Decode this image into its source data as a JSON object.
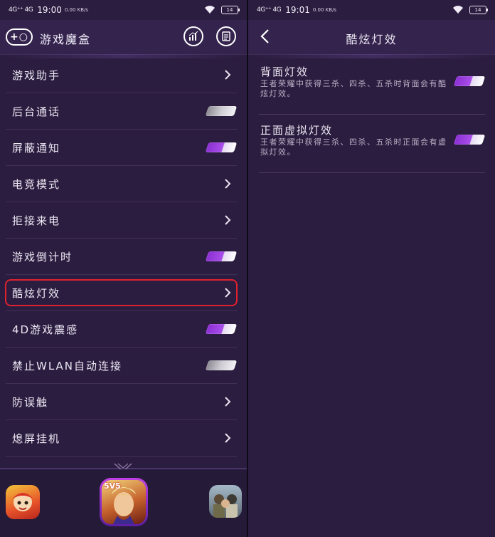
{
  "left": {
    "status": {
      "signal": "4G⁺⁺ 4G",
      "time": "19:00",
      "speed": "0.00 KB/s",
      "battery": "14"
    },
    "header": {
      "title": "游戏魔盒",
      "add_label": "+○"
    },
    "rows": [
      {
        "label": "游戏助手",
        "type": "chevron"
      },
      {
        "label": "后台通话",
        "type": "toggle",
        "on": false
      },
      {
        "label": "屏蔽通知",
        "type": "toggle",
        "on": true
      },
      {
        "label": "电竞模式",
        "type": "chevron"
      },
      {
        "label": "拒接来电",
        "type": "chevron"
      },
      {
        "label": "游戏倒计时",
        "type": "toggle",
        "on": true
      },
      {
        "label": "酷炫灯效",
        "type": "chevron",
        "highlighted": true
      },
      {
        "label": "4D游戏震感",
        "type": "toggle",
        "on": true
      },
      {
        "label": "禁止WLAN自动连接",
        "type": "toggle",
        "on": false
      },
      {
        "label": "防误触",
        "type": "chevron"
      },
      {
        "label": "熄屏挂机",
        "type": "chevron"
      }
    ],
    "dock": {
      "center_badge": "5V5"
    },
    "icons": [
      "add-icon",
      "chart-icon",
      "list-icon"
    ]
  },
  "right": {
    "status": {
      "signal": "4G⁺⁺ 4G",
      "time": "19:01",
      "speed": "0.00 KB/s",
      "battery": "14"
    },
    "header": {
      "title": "酷炫灯效"
    },
    "settings": [
      {
        "title": "背面灯效",
        "desc": "王者荣耀中获得三杀、四杀、五杀时背面会有酷炫灯效。",
        "on": true
      },
      {
        "title": "正面虚拟灯效",
        "desc": "王者荣耀中获得三杀、四杀、五杀时正面会有虚拟灯效。",
        "on": true
      }
    ]
  },
  "colors": {
    "background": "#2b1d3f",
    "toggle_on": "#a94ee9",
    "toggle_off": "#cfcdd4",
    "highlight": "#e0212e"
  }
}
